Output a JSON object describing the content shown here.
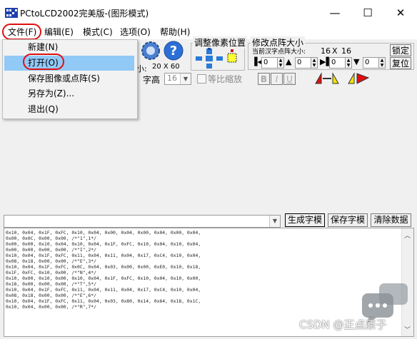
{
  "window": {
    "title": "PCtoLCD2002完美版-(图形模式)",
    "minimize_glyph": "—",
    "maximize_glyph": "☐",
    "close_glyph": "✕"
  },
  "menu": [
    {
      "label": "文件(F)"
    },
    {
      "label": "编辑(E)"
    },
    {
      "label": "模式(C)"
    },
    {
      "label": "选项(O)"
    },
    {
      "label": "帮助(H)"
    }
  ],
  "file_menu": {
    "items": [
      {
        "label": "新建(N)",
        "selected": false
      },
      {
        "label": "打开(O)",
        "selected": true
      },
      {
        "label": "保存图像或点阵(S)",
        "selected": false
      },
      {
        "label": "另存为(Z)...",
        "selected": false
      },
      {
        "label": "退出(Q)",
        "selected": false
      }
    ]
  },
  "toolbar": {
    "size_label": "小:",
    "size_value": "20 X 60",
    "font_height_label": "字高",
    "font_height_value": "16",
    "proportional_label": "等比缩放",
    "bold_label": "B",
    "italic_label": "I",
    "underline_label": "U",
    "adjust_pixel_group": "调整像素位置",
    "resize_group": "修改点阵大小",
    "current_size_label": "当前汉字点阵大小:",
    "width": "16",
    "x": "X",
    "height": "16",
    "lock_button": "锁定",
    "restore_button": "复位",
    "spin_values": [
      "0",
      "0",
      "0",
      "0"
    ]
  },
  "actions": {
    "generate_button": "生成字模",
    "save_button": "保存字模",
    "clear_button": "清除数据"
  },
  "data_lines": [
    "0x10, 0x04, 0x1F, 0xFC, 0x10, 0x04, 0x00, 0x04, 0x00, 0x04, 0x00, 0x04,",
    "0x00, 0x0C, 0x00, 0x00, /*\"1\",1*/",
    "0x00, 0x00, 0x10, 0x04, 0x10, 0x04, 0x1F, 0xFC, 0x10, 0x04, 0x10, 0x04,",
    "0x00, 0x00, 0x00, 0x00, /*\"I\",2*/",
    "0x10, 0x04, 0x1F, 0xFC, 0x11, 0x04, 0x11, 0x04, 0x17, 0xC4, 0x10, 0x04,",
    "0x08, 0x18, 0x00, 0x00, /*\"E\",3*/",
    "0x10, 0x04, 0x1F, 0xFC, 0x0C, 0x04, 0x03, 0x00, 0x00, 0xE0, 0x10, 0x18,",
    "0x1F, 0xFC, 0x10, 0x00, /*\"N\",4*/",
    "0x10, 0x00, 0x10, 0x00, 0x10, 0x04, 0x1F, 0xFC, 0x10, 0x04, 0x10, 0x00,",
    "0x18, 0x00, 0x00, 0x00, /*\"T\",5*/",
    "0x10, 0x04, 0x1F, 0xFC, 0x11, 0x04, 0x11, 0x04, 0x17, 0xC4, 0x10, 0x04,",
    "0x08, 0x18, 0x00, 0x00, /*\"E\",6*/",
    "0x10, 0x04, 0x1F, 0xFC, 0x11, 0x04, 0x03, 0x80, 0x14, 0x64, 0x18, 0x1C,",
    "0x10, 0x04, 0x00, 0x00, /*\"R\",7*/"
  ],
  "watermark": "CSDN @正点原子",
  "colors": {
    "highlight_oval": "#e01010",
    "selected_item": "#91c9f7"
  },
  "icons": [
    "app-icon",
    "gear-icon",
    "help-icon"
  ]
}
